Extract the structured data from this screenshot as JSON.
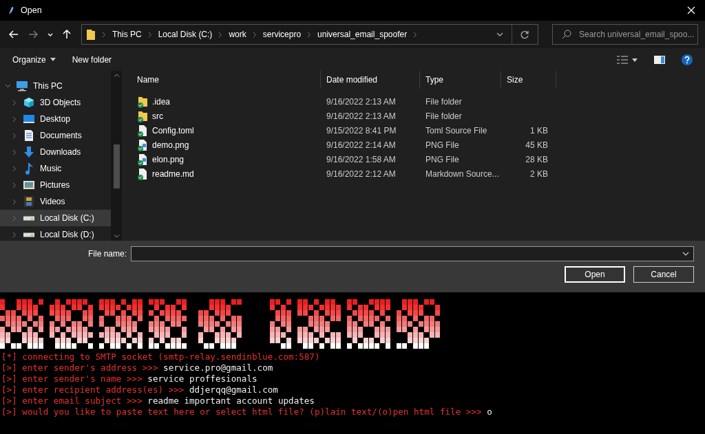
{
  "window": {
    "title": "Open"
  },
  "address_bar": {
    "path": [
      "This PC",
      "Local Disk (C:)",
      "work",
      "servicepro",
      "universal_email_spoofer"
    ]
  },
  "search": {
    "placeholder": "Search universal_email_spoo..."
  },
  "toolbar": {
    "buttons": [
      "Organize",
      "New folder"
    ]
  },
  "nav_pane": {
    "items": [
      {
        "label": "This PC",
        "kind": "pc",
        "expanded": true,
        "selected": false,
        "children": [
          {
            "label": "3D Objects",
            "kind": "cube",
            "selected": false
          },
          {
            "label": "Desktop",
            "kind": "desktop",
            "selected": false
          },
          {
            "label": "Documents",
            "kind": "document",
            "selected": false
          },
          {
            "label": "Downloads",
            "kind": "download",
            "selected": false
          },
          {
            "label": "Music",
            "kind": "music",
            "selected": false
          },
          {
            "label": "Pictures",
            "kind": "pictures",
            "selected": false
          },
          {
            "label": "Videos",
            "kind": "videos",
            "selected": false
          },
          {
            "label": "Local Disk (C:)",
            "kind": "drive",
            "selected": true
          },
          {
            "label": "Local Disk (D:)",
            "kind": "drive",
            "selected": false
          }
        ]
      }
    ]
  },
  "table": {
    "columns": [
      "Name",
      "Date modified",
      "Type",
      "Size"
    ],
    "rows": [
      {
        "kind": "folder",
        "name": ".idea",
        "date": "9/16/2022 2:13 AM",
        "type": "File folder"
      },
      {
        "kind": "folder",
        "name": "src",
        "date": "9/16/2022 2:13 AM",
        "type": "File folder"
      },
      {
        "kind": "file",
        "name": "Config.toml",
        "date": "9/15/2022 8:41 PM",
        "type": "Toml Source File",
        "size": "1 KB"
      },
      {
        "kind": "image",
        "name": "demo.png",
        "date": "9/16/2022 2:14 AM",
        "type": "PNG File",
        "size": "45 KB"
      },
      {
        "kind": "image",
        "name": "elon.png",
        "date": "9/16/2022 1:58 AM",
        "type": "PNG File",
        "size": "28 KB"
      },
      {
        "kind": "file",
        "name": "readme.md",
        "date": "9/16/2022 2:12 AM",
        "type": "Markdown Source...",
        "size": "2 KB"
      }
    ]
  },
  "file_name": {
    "label": "File name:"
  },
  "buttons": [
    "Open",
    "Cancel"
  ],
  "terminal": {
    "lines": [
      {
        "marker": "[*]",
        "prompt": "connecting to SMTP socket (smtp-relay.sendinblue.com:587)"
      },
      {
        "marker": "[>]",
        "prompt": "enter sender's address >>>",
        "answer": "service.pro@gmail.com"
      },
      {
        "marker": "[>]",
        "prompt": "enter sender's name >>>",
        "answer": "service proffesionals"
      },
      {
        "marker": "[>]",
        "prompt": "enter recipient address(es) >>>",
        "answer": "ddjerqq@gmail.com"
      },
      {
        "marker": "[>]",
        "prompt": "enter email subject >>>",
        "answer": "readme important account updates"
      },
      {
        "marker": "[>]",
        "prompt": "would you like to paste text here or select html file? (p)lain text/(o)pen html file >>>",
        "answer": "o"
      }
    ]
  }
}
